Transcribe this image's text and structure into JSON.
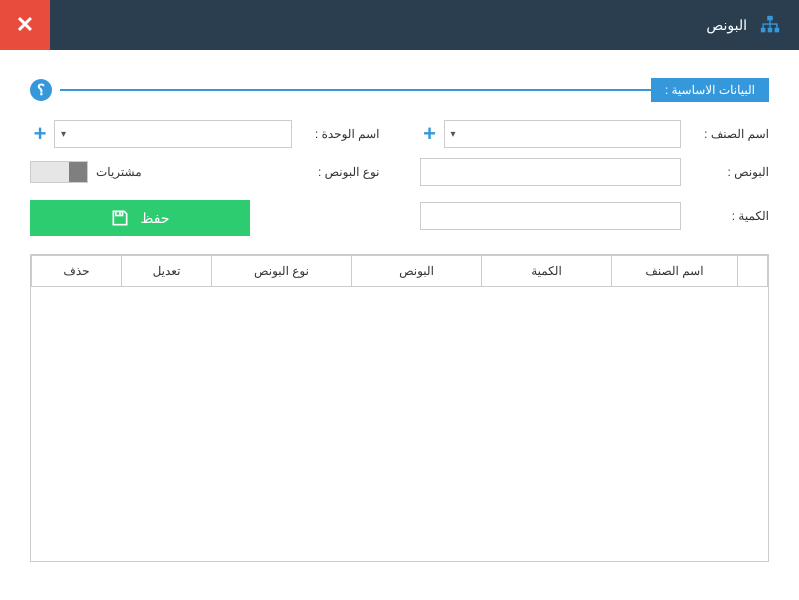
{
  "header": {
    "title": "البونص"
  },
  "section": {
    "label": "البيانات الاساسية :"
  },
  "form": {
    "item_name_label": "اسم الصنف :",
    "unit_name_label": "اسم الوحدة :",
    "bonus_label": "البونص :",
    "bonus_type_label": "نوع البونص :",
    "qty_label": "الكمية :",
    "toggle_label": "مشتريات",
    "save_label": "حفظ",
    "help_symbol": "؟",
    "plus_symbol": "+"
  },
  "table": {
    "columns": {
      "item_name": "اسم الصنف",
      "qty": "الكمية",
      "bonus": "البونص",
      "bonus_type": "نوع البونص",
      "edit": "تعديل",
      "delete": "حذف"
    }
  }
}
